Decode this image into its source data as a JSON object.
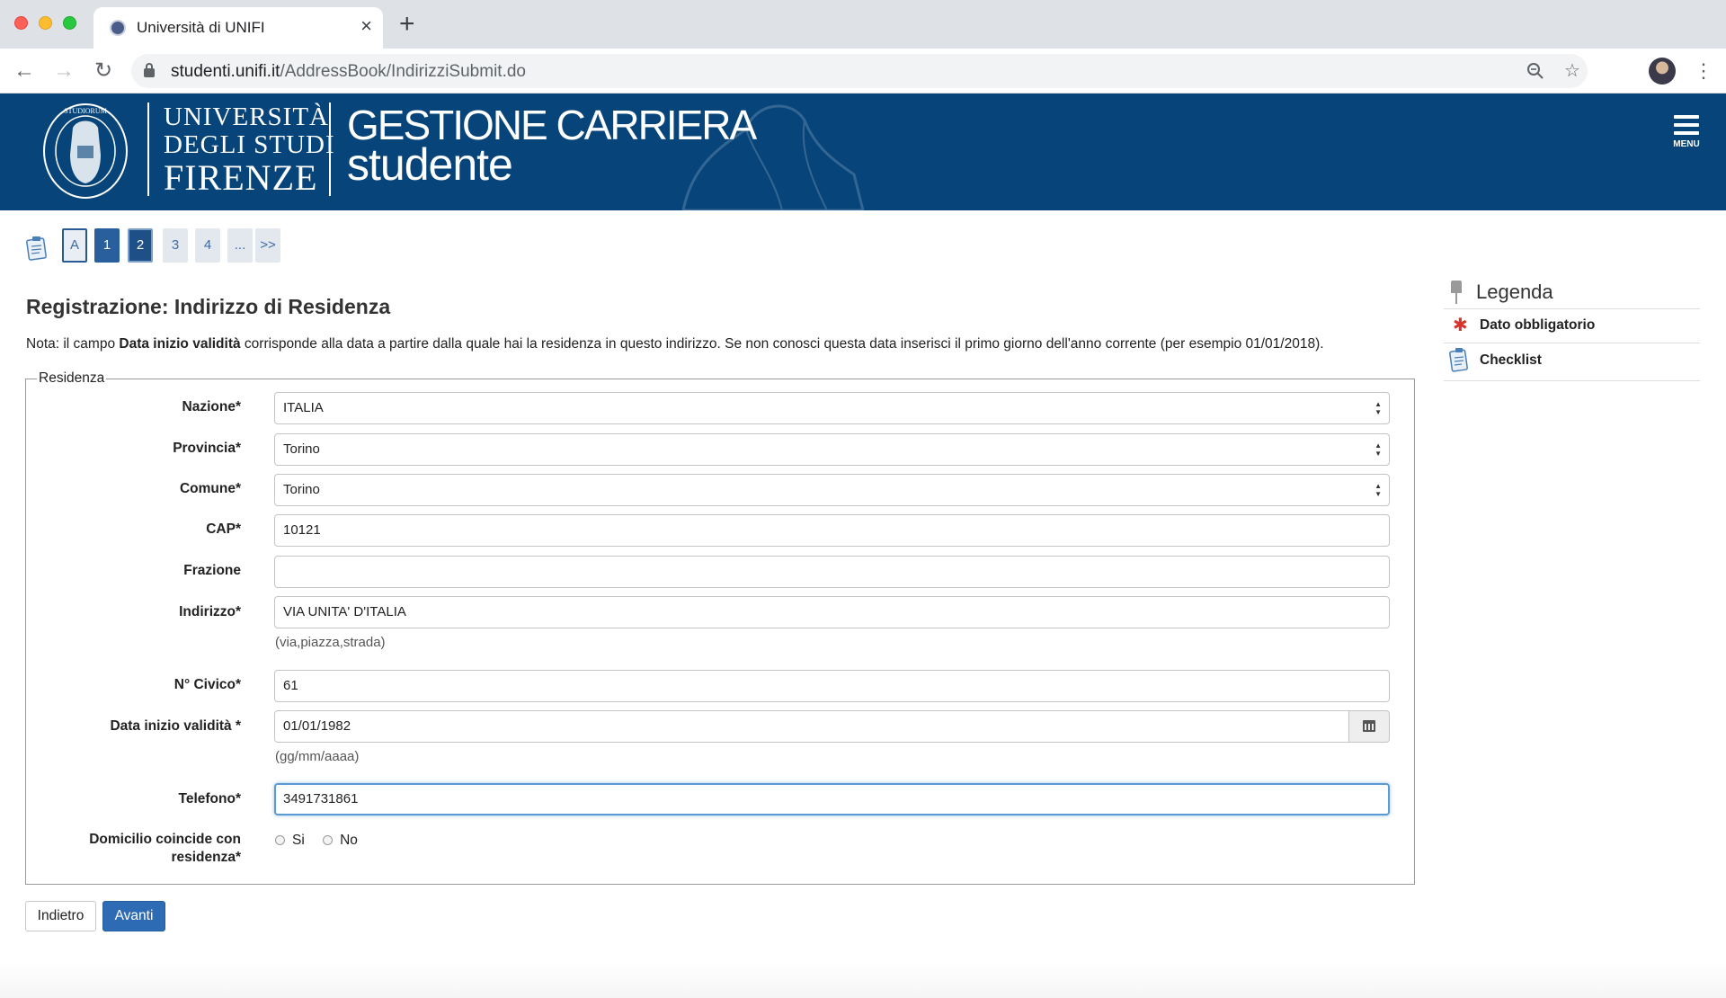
{
  "browser": {
    "tab_title": "Università di UNIFI",
    "url_host": "studenti.unifi.it",
    "url_path": "/AddressBook/IndirizziSubmit.do"
  },
  "banner": {
    "uni_line1": "UNIVERSITÀ",
    "uni_line2": "DEGLI STUDI",
    "uni_line3": "FIRENZE",
    "app_line1": "GESTIONE CARRIERA",
    "app_line2": "studente",
    "menu_label": "MENU"
  },
  "steps": [
    "A",
    "1",
    "2",
    "3",
    "4",
    "...",
    ">>"
  ],
  "page": {
    "title": "Registrazione: Indirizzo di Residenza",
    "note_prefix": "Nota: il campo ",
    "note_bold": "Data inizio validità",
    "note_suffix": " corrisponde alla data a partire dalla quale hai la residenza in questo indirizzo. Se non conosci questa data inserisci il primo giorno dell'anno corrente (per esempio 01/01/2018)."
  },
  "form": {
    "legend": "Residenza",
    "nazione": {
      "label": "Nazione*",
      "value": "ITALIA"
    },
    "provincia": {
      "label": "Provincia*",
      "value": "Torino"
    },
    "comune": {
      "label": "Comune*",
      "value": "Torino"
    },
    "cap": {
      "label": "CAP*",
      "value": "10121"
    },
    "frazione": {
      "label": "Frazione",
      "value": ""
    },
    "indirizzo": {
      "label": "Indirizzo*",
      "value": "VIA UNITA' D'ITALIA",
      "hint": "(via,piazza,strada)"
    },
    "civico": {
      "label": "N° Civico*",
      "value": "61"
    },
    "data": {
      "label": "Data inizio validità *",
      "value": "01/01/1982",
      "hint": "(gg/mm/aaaa)"
    },
    "telefono": {
      "label": "Telefono*",
      "value": "3491731861"
    },
    "domicilio": {
      "label_line1": "Domicilio coincide con",
      "label_line2": "residenza*",
      "opt_si": "Si",
      "opt_no": "No"
    }
  },
  "buttons": {
    "back": "Indietro",
    "next": "Avanti"
  },
  "legend": {
    "title": "Legenda",
    "required": "Dato obbligatorio",
    "checklist": "Checklist"
  },
  "colors": {
    "banner": "#06447a",
    "primary_button": "#2d6cb4",
    "required_star": "#d9342b"
  }
}
